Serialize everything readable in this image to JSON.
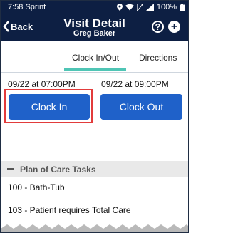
{
  "status_bar": {
    "time_carrier": "7:58 Sprint",
    "battery": "100%"
  },
  "header": {
    "back_label": "Back",
    "title": "Visit Detail",
    "subtitle": "Greg Baker",
    "help_glyph": "?",
    "add_glyph": "+"
  },
  "tabs": [
    {
      "label": "Clock In/Out",
      "active": true
    },
    {
      "label": "Directions",
      "active": false
    }
  ],
  "clock": {
    "in_time": "09/22 at  07:00PM",
    "out_time": "09/22 at  09:00PM",
    "in_label": "Clock In",
    "out_label": "Clock Out"
  },
  "plan_of_care": {
    "title": "Plan of Care Tasks",
    "tasks": [
      "100 - Bath-Tub",
      "103 - Patient requires Total Care"
    ]
  },
  "colors": {
    "header_bg": "#0d1f43",
    "button": "#1f61c9",
    "tab_indicator": "#4fc5b5",
    "highlight": "#e23b3b"
  }
}
